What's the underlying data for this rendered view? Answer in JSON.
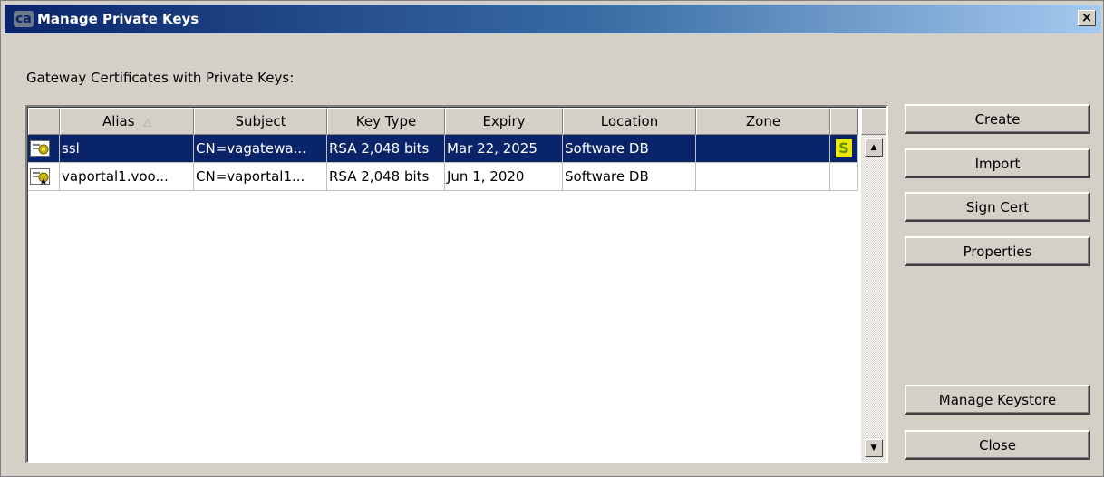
{
  "window": {
    "title": "Manage Private Keys",
    "app_icon_text": "ca",
    "close_glyph": "×"
  },
  "label": "Gateway Certificates with Private Keys:",
  "table": {
    "columns": [
      "",
      "Alias",
      "Subject",
      "Key Type",
      "Expiry",
      "Location",
      "Zone",
      ""
    ],
    "sort_indicator": "△",
    "rows": [
      {
        "alias": "ssl",
        "subject": "CN=vagatewa...",
        "key_type": "RSA 2,048 bits",
        "expiry": "Mar 22, 2025",
        "location": "Software DB",
        "zone": "",
        "badge": "S",
        "selected": true
      },
      {
        "alias": "vaportal1.voo...",
        "subject": "CN=vaportal1...",
        "key_type": "RSA 2,048 bits",
        "expiry": "Jun 1, 2020",
        "location": "Software DB",
        "zone": "",
        "badge": "",
        "selected": false
      }
    ]
  },
  "buttons": {
    "create": "Create",
    "import": "Import",
    "sign_cert": "Sign Cert",
    "properties": "Properties",
    "manage_keystore": "Manage Keystore",
    "close": "Close"
  },
  "icons": {
    "app": "ca-logo-icon",
    "certificate": "certificate-icon",
    "close": "close-icon",
    "scroll_up": "arrow-up-icon",
    "scroll_down": "arrow-down-icon"
  },
  "colors": {
    "title_bar_start": "#0a246a",
    "selection": "#0a246a",
    "badge": "#e8e800",
    "face": "#d4d0c8"
  }
}
